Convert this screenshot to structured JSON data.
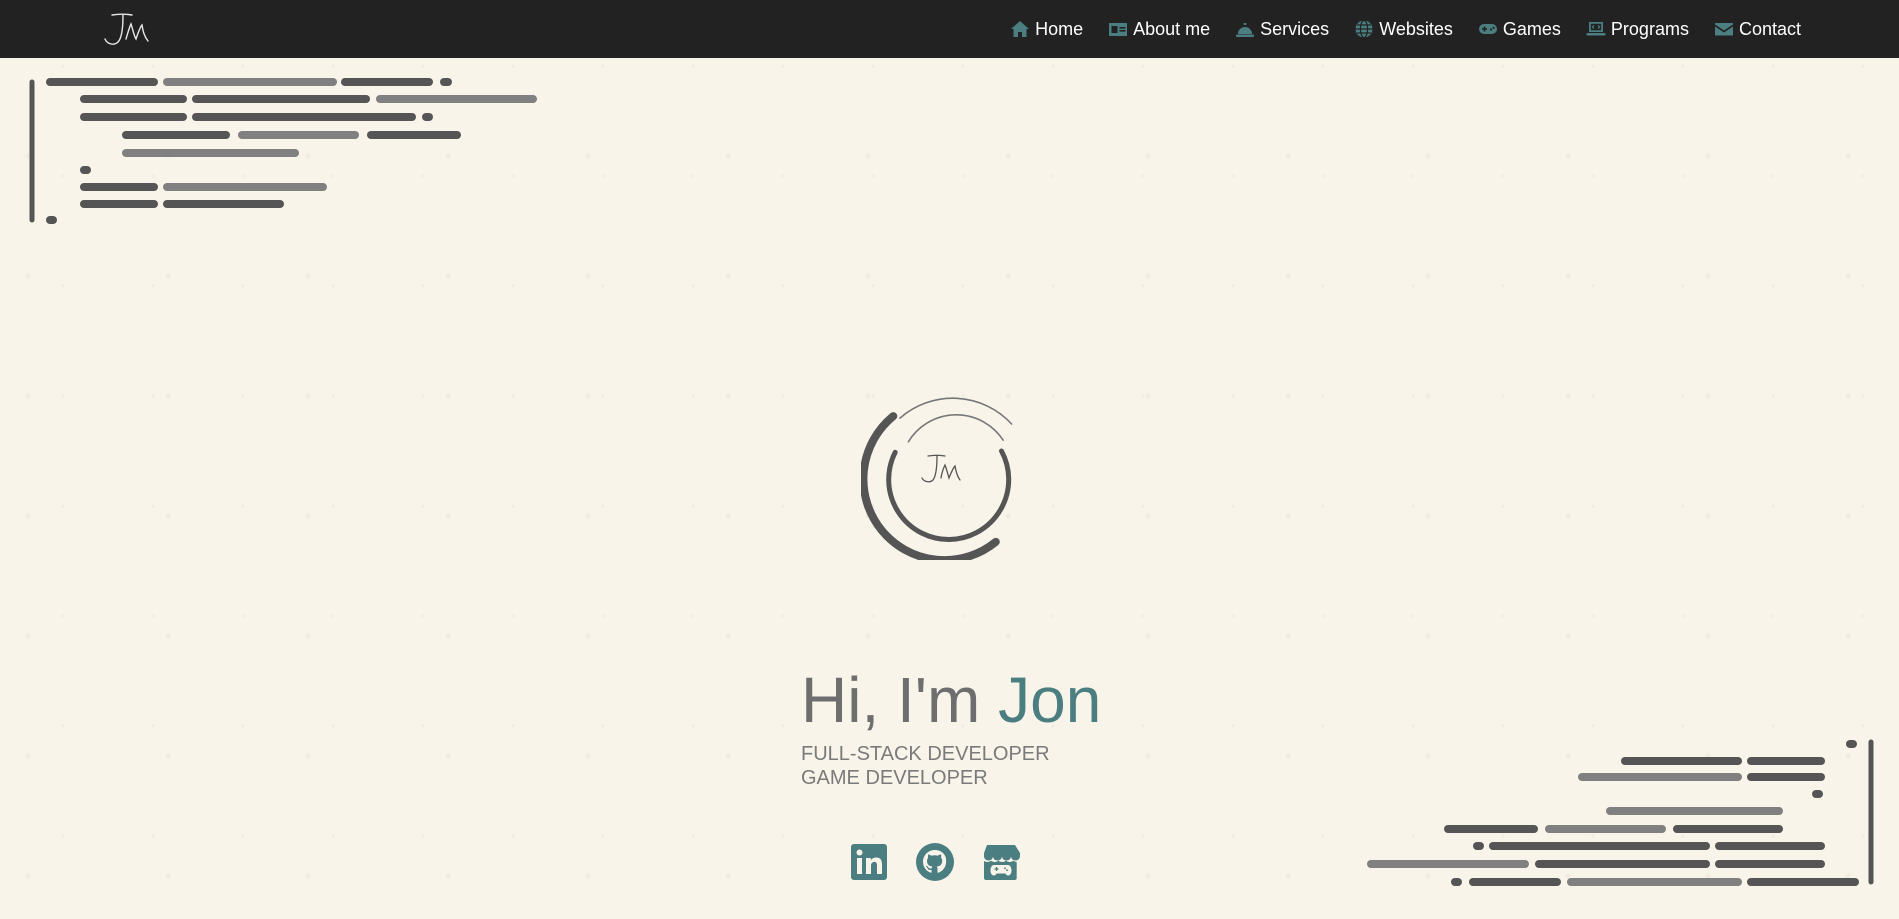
{
  "brand": {
    "initials": "JM"
  },
  "nav": {
    "items": [
      {
        "label": "Home",
        "icon": "home-icon"
      },
      {
        "label": "About me",
        "icon": "id-card-icon"
      },
      {
        "label": "Services",
        "icon": "service-bell-icon"
      },
      {
        "label": "Websites",
        "icon": "globe-icon"
      },
      {
        "label": "Games",
        "icon": "gamepad-icon"
      },
      {
        "label": "Programs",
        "icon": "laptop-code-icon"
      },
      {
        "label": "Contact",
        "icon": "envelope-icon"
      }
    ]
  },
  "hero": {
    "greeting": "Hi, I'm",
    "name": "Jon",
    "roles": [
      "FULL-STACK DEVELOPER",
      "GAME DEVELOPER"
    ],
    "logo_initials": "JM"
  },
  "socials": [
    {
      "icon": "linkedin-icon"
    },
    {
      "icon": "github-icon"
    },
    {
      "icon": "itchio-icon"
    }
  ],
  "colors": {
    "navbar": "#222222",
    "accent": "#4b7e80",
    "text_gray": "#6e6e6e",
    "background": "#f8f4ea",
    "code_dark": "#555555",
    "code_light": "#808080"
  }
}
